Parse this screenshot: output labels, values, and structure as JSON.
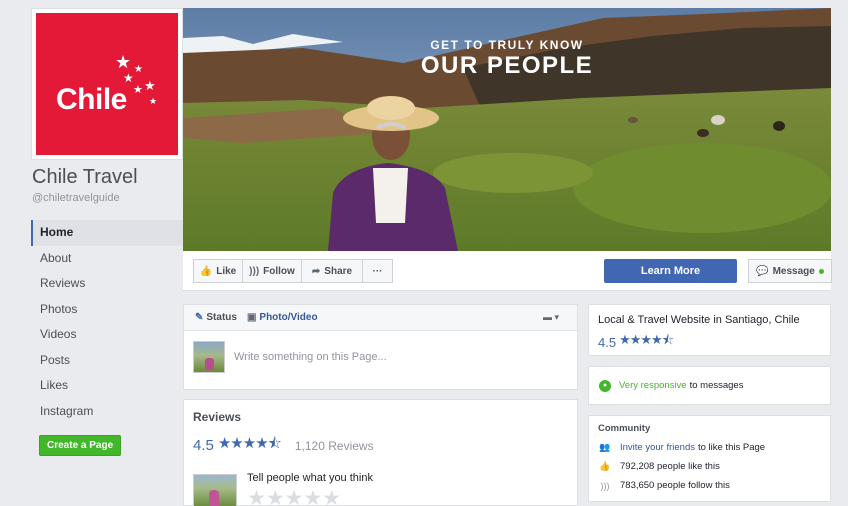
{
  "brand": {
    "logo_text": "Chile",
    "red": "#e31937",
    "blue": "#4267b2",
    "green": "#42b72a"
  },
  "page": {
    "name": "Chile Travel",
    "handle": "@chiletravelguide"
  },
  "nav": {
    "items": [
      {
        "label": "Home",
        "active": true
      },
      {
        "label": "About"
      },
      {
        "label": "Reviews"
      },
      {
        "label": "Photos"
      },
      {
        "label": "Videos"
      },
      {
        "label": "Posts"
      },
      {
        "label": "Likes"
      },
      {
        "label": "Instagram"
      }
    ],
    "create_page_label": "Create a Page"
  },
  "cover": {
    "line1": "GET TO TRULY KNOW",
    "line2": "OUR PEOPLE"
  },
  "actions": {
    "like": "Like",
    "follow": "Follow",
    "share": "Share",
    "more": "···",
    "learn_more": "Learn More",
    "message": "Message"
  },
  "composer": {
    "tab_status": "Status",
    "tab_photo": "Photo/Video",
    "placeholder": "Write something on this Page..."
  },
  "reviews": {
    "title": "Reviews",
    "score": "4.5",
    "count": "1,120 Reviews",
    "prompt": "Tell people what you think"
  },
  "about": {
    "category": "Local & Travel Website in Santiago, Chile",
    "rating": "4.5"
  },
  "responsiveness": {
    "highlight": "Very responsive",
    "rest": "to messages"
  },
  "community": {
    "title": "Community",
    "invite_link": "Invite your friends",
    "invite_rest": "to like this Page",
    "likes": "792,208 people like this",
    "follows": "783,650 people follow this"
  }
}
